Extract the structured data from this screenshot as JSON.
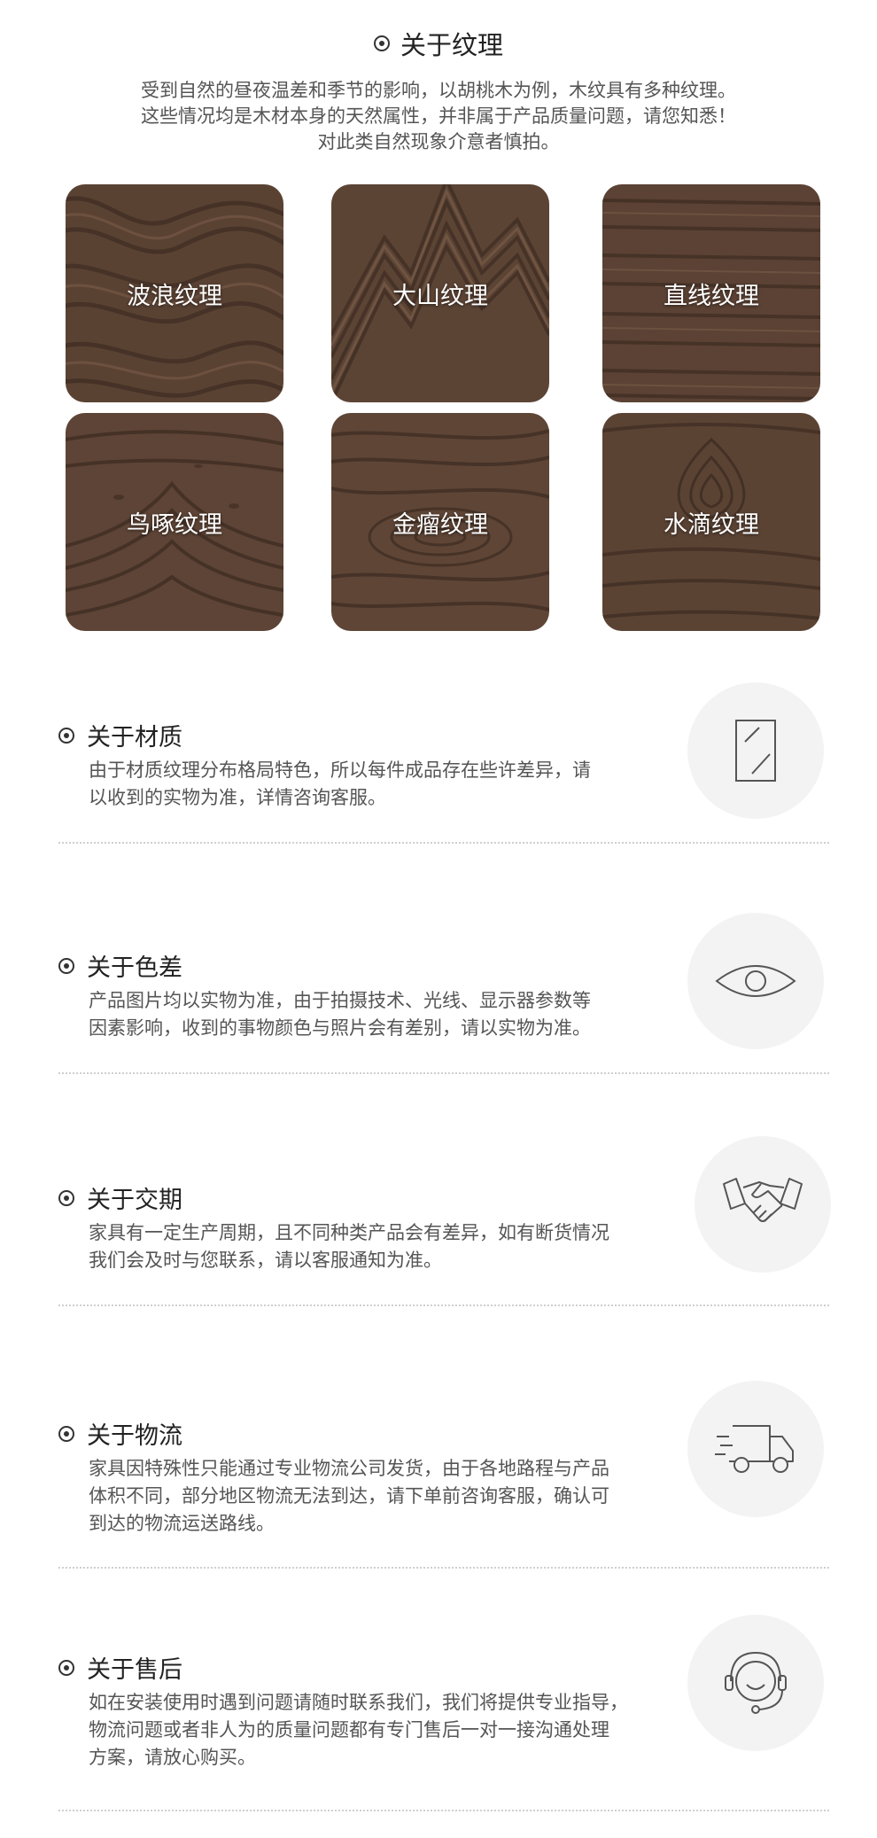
{
  "texture": {
    "title": "关于纹理",
    "desc_lines": [
      "受到自然的昼夜温差和季节的影响，以胡桃木为例，木纹具有多种纹理。",
      "这些情况均是木材本身的天然属性，并非属于产品质量问题，请您知悉！",
      "对此类自然现象介意者慎拍。"
    ],
    "tiles": [
      "波浪纹理",
      "大山纹理",
      "直线纹理",
      "鸟啄纹理",
      "金瘤纹理",
      "水滴纹理"
    ]
  },
  "sections": [
    {
      "title": "关于材质",
      "lines": [
        "由于材质纹理分布格局特色，所以每件成品存在些许差异，请",
        "以收到的实物为准，详情咨询客服。"
      ],
      "icon": "glass-frame-icon"
    },
    {
      "title": "关于色差",
      "lines": [
        "产品图片均以实物为准，由于拍摄技术、光线、显示器参数等",
        "因素影响，收到的事物颜色与照片会有差别，请以实物为准。"
      ],
      "icon": "eye-icon"
    },
    {
      "title": "关于交期",
      "lines": [
        "家具有一定生产周期，且不同种类产品会有差异，如有断货情况",
        "我们会及时与您联系，请以客服通知为准。"
      ],
      "icon": "handshake-icon"
    },
    {
      "title": "关于物流",
      "lines": [
        "家具因特殊性只能通过专业物流公司发货，由于各地路程与产品",
        "体积不同，部分地区物流无法到达，请下单前咨询客服，确认可",
        "到达的物流运送路线。"
      ],
      "icon": "truck-icon"
    },
    {
      "title": "关于售后",
      "lines": [
        "如在安装使用时遇到问题请随时联系我们，我们将提供专业指导，",
        "物流问题或者非人为的质量问题都有专门售后一对一接沟通处理",
        "方案，请放心购买。"
      ],
      "icon": "headset-icon"
    }
  ],
  "colors": {
    "wood_dark": "#4a362b",
    "wood_mid": "#6b5040",
    "wood_light": "#8a6a55",
    "icon_bg": "#f3f3f3"
  }
}
